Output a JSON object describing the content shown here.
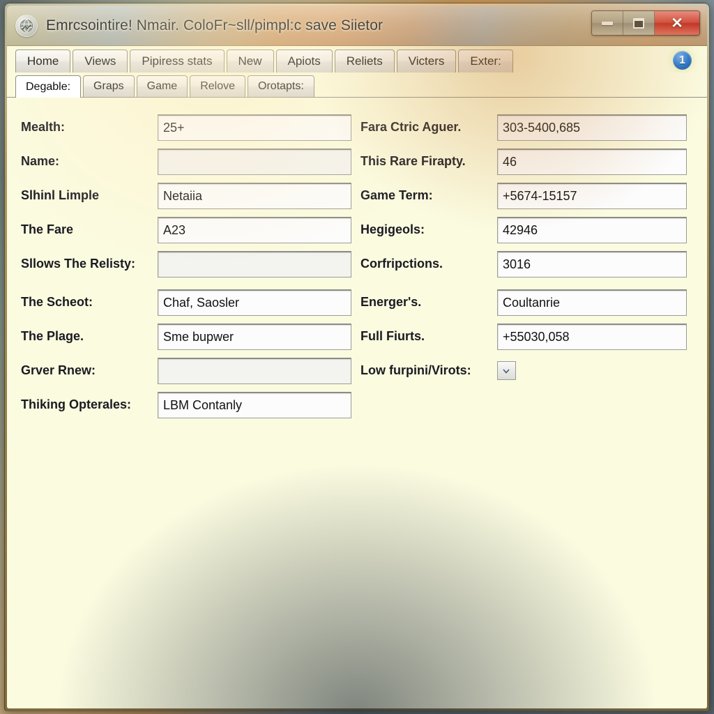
{
  "window": {
    "title": "Emrcsointire! Nmair. ColoFr~sll/pimpl:c save Siietor",
    "icon": "app-globe-icon",
    "controls": {
      "minimize": "minimize-icon",
      "maximize": "maximize-icon",
      "close": "✕"
    }
  },
  "ribbon": {
    "tabs": [
      {
        "label": "Home"
      },
      {
        "label": "Views"
      },
      {
        "label": "Pipiress stats"
      },
      {
        "label": "New"
      },
      {
        "label": "Apiots"
      },
      {
        "label": "Reliets"
      },
      {
        "label": "Victers"
      },
      {
        "label": "Exter:"
      }
    ],
    "badge": "1"
  },
  "subtabs": {
    "tabs": [
      {
        "label": "Degable:",
        "active": true
      },
      {
        "label": "Graps",
        "active": false
      },
      {
        "label": "Game",
        "active": false
      },
      {
        "label": "Relove",
        "active": false
      },
      {
        "label": "Orotapts:",
        "active": false
      }
    ]
  },
  "form": {
    "left": [
      {
        "label": "Mealth:",
        "value": "25+",
        "empty": false,
        "gap": false
      },
      {
        "label": "Name:",
        "value": "",
        "empty": true,
        "gap": false
      },
      {
        "label": "Slhinl Limple",
        "value": "Netaiia",
        "empty": false,
        "gap": false
      },
      {
        "label": "The Fare",
        "value": "A23",
        "empty": false,
        "gap": false
      },
      {
        "label": "Sllows The Relisty:",
        "value": "",
        "empty": true,
        "gap": false
      },
      {
        "label": "The Scheot:",
        "value": "Chaf, Saosler",
        "empty": false,
        "gap": true
      },
      {
        "label": "The Plage.",
        "value": "Sme bupwer",
        "empty": false,
        "gap": false
      },
      {
        "label": "Grver Rnew:",
        "value": "",
        "empty": true,
        "gap": false
      },
      {
        "label": "Thiking Opterales:",
        "value": "LBM Contanly",
        "empty": false,
        "gap": false
      }
    ],
    "right": [
      {
        "label": "Fara Ctric Aguer.",
        "value": "303-5400,685",
        "type": "text",
        "empty": false,
        "gap": false
      },
      {
        "label": "This Rare Firapty.",
        "value": "46",
        "type": "text",
        "empty": false,
        "gap": false
      },
      {
        "label": "Game Term:",
        "value": "+5674-15157",
        "type": "text",
        "empty": false,
        "gap": false
      },
      {
        "label": "Hegigeols:",
        "value": "42946",
        "type": "text",
        "empty": false,
        "gap": false
      },
      {
        "label": "Corfripctions.",
        "value": "3016",
        "type": "text",
        "empty": false,
        "gap": false
      },
      {
        "label": "Energer's.",
        "value": "Coultanrie",
        "type": "text",
        "empty": false,
        "gap": true
      },
      {
        "label": "Full Fiurts.",
        "value": "+55030,058",
        "type": "text",
        "empty": false,
        "gap": false
      },
      {
        "label": "Low furpini/Virots:",
        "value": "",
        "type": "combo",
        "empty": false,
        "gap": false
      }
    ]
  },
  "colors": {
    "client_background": "#fbfbe0",
    "frame": "#96814a",
    "badge_blue": "#2f7fd4",
    "close_red": "#d24b3c"
  }
}
